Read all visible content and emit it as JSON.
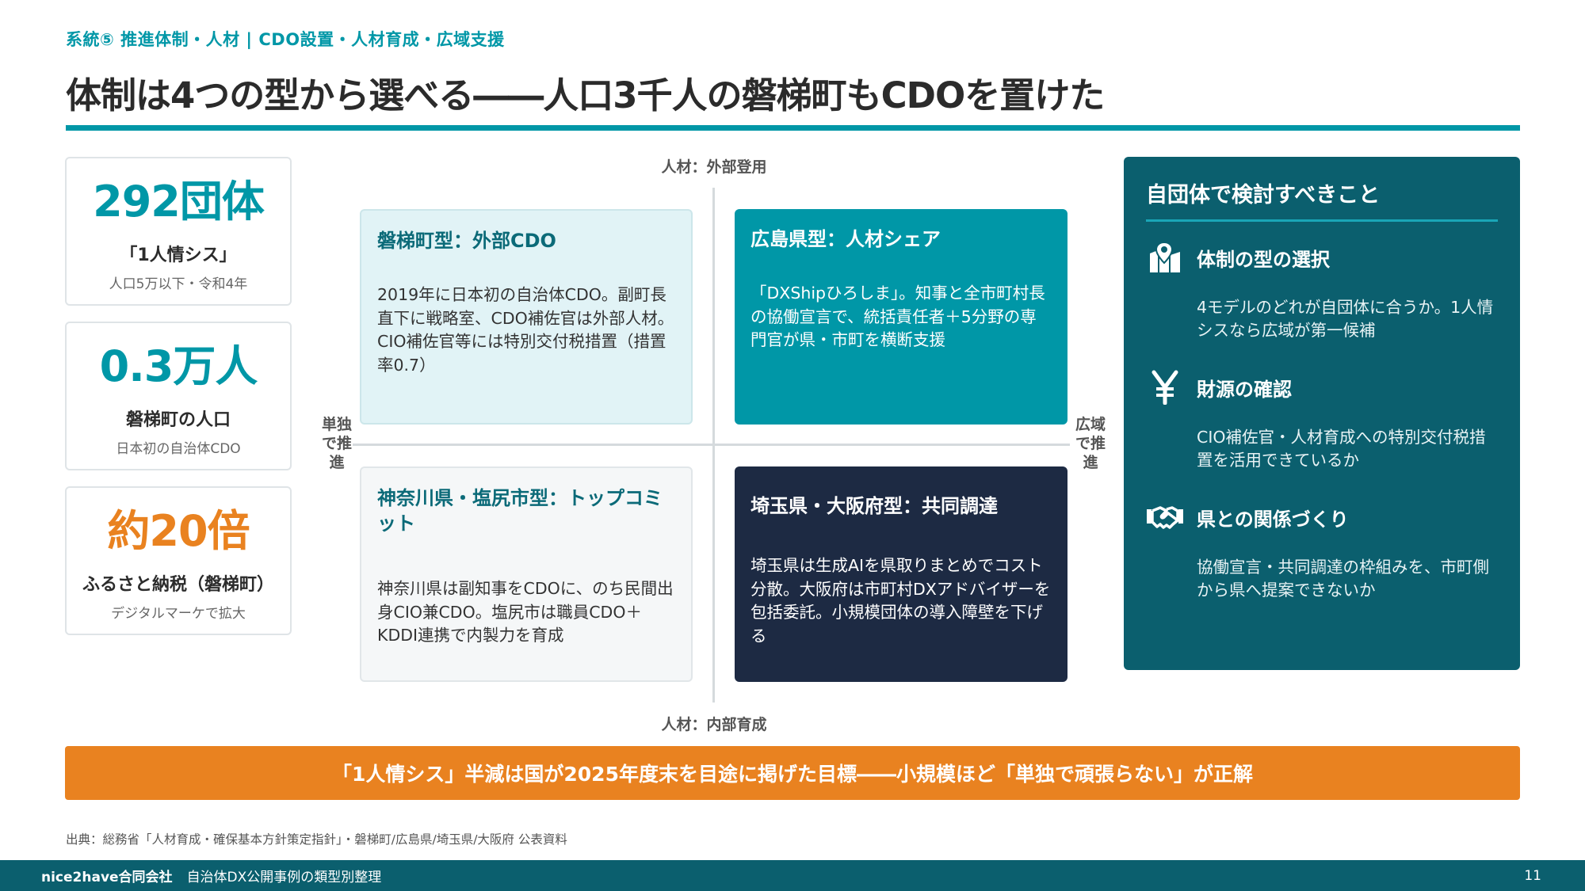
{
  "header": {
    "eyebrow": "系統⑤ 推進体制・人材 | CDO設置・人材育成・広域支援",
    "title": "体制は4つの型から選べる――人口3千人の磐梯町もCDOを置けた"
  },
  "stats": [
    {
      "value": "292団体",
      "label": "「1人情シス」",
      "sub": "人口5万以下・令和4年",
      "color": "#0097a7"
    },
    {
      "value": "0.3万人",
      "label": "磐梯町の人口",
      "sub": "日本初の自治体CDO",
      "color": "#0097a7"
    },
    {
      "value": "約20倍",
      "label": "ふるさと納税（磐梯町）",
      "sub": "デジタルマーケで拡大",
      "color": "#e98220"
    }
  ],
  "matrix": {
    "axis_top": "人材：外部登用",
    "axis_bottom": "人材：内部育成",
    "axis_left": "単独で推進",
    "axis_right": "広域で推進",
    "quadrants": [
      {
        "title": "磐梯町型：外部CDO",
        "body": "2019年に日本初の自治体CDO。副町長直下に戦略室、CDO補佐官は外部人材。CIO補佐官等には特別交付税措置（措置率0.7）"
      },
      {
        "title": "広島県型：人材シェア",
        "body": "「DXShipひろしま」。知事と全市町村長の協働宣言で、統括責任者＋5分野の専門官が県・市町を横断支援"
      },
      {
        "title": "神奈川県・塩尻市型：トップコミット",
        "body": "神奈川県は副知事をCDOに、のち民間出身CIO兼CDO。塩尻市は職員CDO＋KDDI連携で内製力を育成"
      },
      {
        "title": "埼玉県・大阪府型：共同調達",
        "body": "埼玉県は生成AIを県取りまとめでコスト分散。大阪府は市町村DXアドバイザーを包括委託。小規模団体の導入障壁を下げる"
      }
    ]
  },
  "panel": {
    "heading": "自団体で検討すべきこと",
    "items": [
      {
        "icon": "map-pin-icon",
        "title": "体制の型の選択",
        "body": "4モデルのどれが自団体に合うか。1人情シスなら広域が第一候補"
      },
      {
        "icon": "yen-icon",
        "title": "財源の確認",
        "body": "CIO補佐官・人材育成への特別交付税措置を活用できているか"
      },
      {
        "icon": "handshake-icon",
        "title": "県との関係づくり",
        "body": "協働宣言・共同調達の枠組みを、市町側から県へ提案できないか"
      }
    ]
  },
  "banner": "「1人情シス」半減は国が2025年度末を目途に掲げた目標――小規模ほど「単独で頑張らない」が正解",
  "source": "出典：総務省「人材育成・確保基本方針策定指針」・磐梯町/広島県/埼玉県/大阪府 公表資料",
  "footer": {
    "brand": "nice2have合同会社",
    "title": "自治体DX公開事例の類型別整理",
    "page": "11"
  }
}
